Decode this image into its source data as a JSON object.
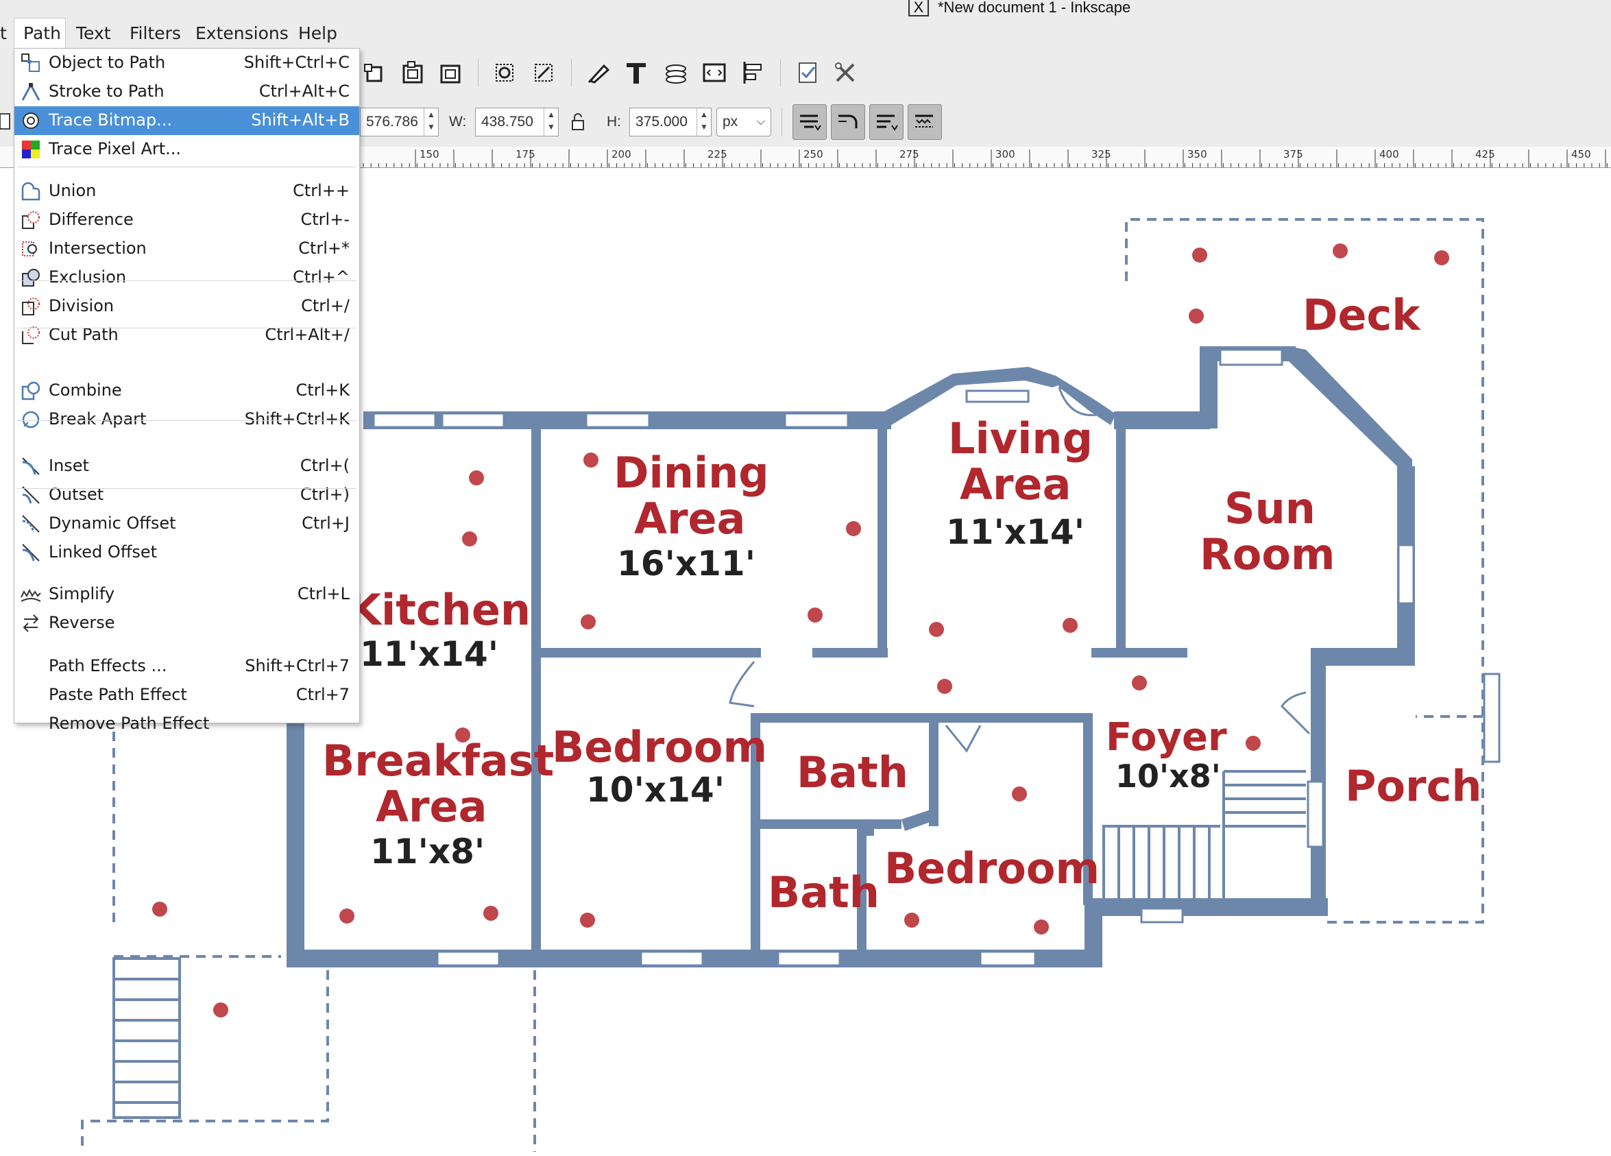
{
  "window": {
    "title": "*New document 1 - Inkscape"
  },
  "menubar": {
    "items": [
      {
        "label": "t"
      },
      {
        "label": "Path"
      },
      {
        "label": "Text"
      },
      {
        "label": "Filters"
      },
      {
        "label": "Extensions"
      },
      {
        "label": "Help"
      }
    ]
  },
  "toolbar": {
    "x_value": "576.786",
    "w_label": "W:",
    "w_value": "438.750",
    "h_label": "H:",
    "h_value": "375.000",
    "unit": "px",
    "lock_icon": "lock-icon"
  },
  "ruler": {
    "ticks": [
      "150",
      "175",
      "200",
      "225",
      "250",
      "275",
      "300",
      "325",
      "350",
      "375",
      "400",
      "425",
      "450"
    ]
  },
  "path_menu": {
    "items": [
      {
        "label": "Object to Path",
        "shortcut": "Shift+Ctrl+C",
        "icon": "object-to-path-icon"
      },
      {
        "label": "Stroke to Path",
        "shortcut": "Ctrl+Alt+C",
        "icon": "stroke-to-path-icon"
      },
      {
        "label": "Trace Bitmap...",
        "shortcut": "Shift+Alt+B",
        "icon": "trace-bitmap-icon",
        "highlighted": true
      },
      {
        "label": "Trace Pixel Art...",
        "shortcut": "",
        "icon": "trace-pixel-art-icon"
      },
      {
        "label": "Union",
        "shortcut": "Ctrl++",
        "icon": "union-icon"
      },
      {
        "label": "Difference",
        "shortcut": "Ctrl+-",
        "icon": "difference-icon"
      },
      {
        "label": "Intersection",
        "shortcut": "Ctrl+*",
        "icon": "intersection-icon"
      },
      {
        "label": "Exclusion",
        "shortcut": "Ctrl+^",
        "icon": "exclusion-icon"
      },
      {
        "label": "Division",
        "shortcut": "Ctrl+/",
        "icon": "division-icon"
      },
      {
        "label": "Cut Path",
        "shortcut": "Ctrl+Alt+/",
        "icon": "cut-path-icon"
      },
      {
        "label": "Combine",
        "shortcut": "Ctrl+K",
        "icon": "combine-icon"
      },
      {
        "label": "Break Apart",
        "shortcut": "Shift+Ctrl+K",
        "icon": "break-apart-icon"
      },
      {
        "label": "Inset",
        "shortcut": "Ctrl+(",
        "icon": "inset-icon"
      },
      {
        "label": "Outset",
        "shortcut": "Ctrl+)",
        "icon": "outset-icon"
      },
      {
        "label": "Dynamic Offset",
        "shortcut": "Ctrl+J",
        "icon": "dynamic-offset-icon"
      },
      {
        "label": "Linked Offset",
        "shortcut": "",
        "icon": "linked-offset-icon"
      },
      {
        "label": "Simplify",
        "shortcut": "Ctrl+L",
        "icon": "simplify-icon"
      },
      {
        "label": "Reverse",
        "shortcut": "",
        "icon": "reverse-icon"
      },
      {
        "label": "Path Effects ...",
        "shortcut": "Shift+Ctrl+7",
        "icon": ""
      },
      {
        "label": "Paste Path Effect",
        "shortcut": "Ctrl+7",
        "icon": ""
      },
      {
        "label": "Remove Path Effect",
        "shortcut": "",
        "icon": ""
      }
    ]
  },
  "floorplan": {
    "deck": "Deck",
    "living": [
      "Living",
      "Area",
      "11'x14'"
    ],
    "dining": [
      "Dining",
      "Area",
      "16'x11'"
    ],
    "sunroom": [
      "Sun",
      "Room"
    ],
    "kitchen": [
      "Kitchen",
      "11'x14'"
    ],
    "breakfast": [
      "Breakfast",
      "Area",
      "11'x8'"
    ],
    "bedroom1": [
      "Bedroom",
      "10'x14'"
    ],
    "bath1": "Bath",
    "bath2": "Bath",
    "bedroom2": "Bedroom",
    "foyer": [
      "Foyer",
      "10'x8'"
    ],
    "porch": "Porch"
  },
  "colors": {
    "wall": "#6d87ab",
    "label": "#b0272d",
    "dot": "#c0474b",
    "highlight": "#4a90d9"
  }
}
